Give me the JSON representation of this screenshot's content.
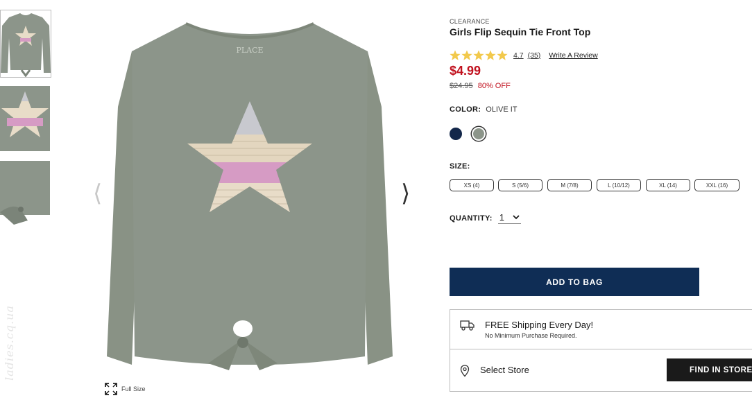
{
  "product": {
    "badge": "CLEARANCE",
    "title": "Girls Flip Sequin Tie Front Top",
    "rating": "4.7",
    "review_count": "(35)",
    "write_review": "Write A Review",
    "price": "$4.99",
    "original_price": "$24.95",
    "discount": "80% OFF",
    "color_label": "COLOR:",
    "color_value": "OLIVE IT",
    "colors": [
      "#13274a",
      "#8c958a"
    ],
    "size_label": "SIZE:",
    "sizes": [
      "XS (4)",
      "S (5/6)",
      "M (7/8)",
      "L (10/12)",
      "XL (14)",
      "XXL (16)"
    ],
    "quantity_label": "QUANTITY:",
    "quantity_value": "1",
    "add_to_bag": "ADD TO BAG"
  },
  "shipping": {
    "title": "FREE Shipping Every Day!",
    "subtitle": "No Minimum Purchase Required."
  },
  "store": {
    "label": "Select Store",
    "button": "FIND IN STORE"
  },
  "gallery": {
    "full_size": "Full Size",
    "watermark": "ladies.cq.ua",
    "shirt_logo": "PLACE"
  },
  "theme": {
    "accent_red": "#c1121f",
    "navy": "#0f2d55",
    "shirt_color": "#8c958a",
    "star_color": "#f2c94c"
  }
}
